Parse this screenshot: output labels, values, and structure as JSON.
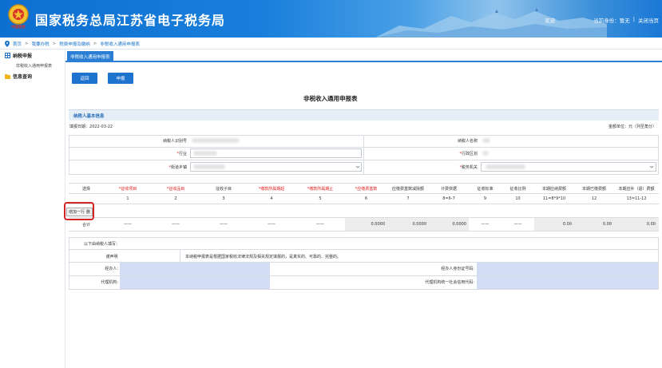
{
  "header": {
    "title": "国家税务总局江苏省电子税务局",
    "emblem_text": "中国税务",
    "links": [
      "欢迎",
      "当前身份：暂无",
      "|",
      "关闭当页"
    ]
  },
  "breadcrumb": [
    "首页",
    "我要办税",
    "税费申报及缴纳",
    "非税收入通用申报表"
  ],
  "sidebar": {
    "groups": [
      {
        "label": "纳税申报",
        "items": [
          "非税收入通用申报表"
        ]
      },
      {
        "label": "信息查询",
        "items": []
      }
    ]
  },
  "tab": {
    "label": "非税收入通用申报表"
  },
  "buttons": {
    "back": "返回",
    "declare": "申报"
  },
  "form_title": "非税收入通用申报表",
  "section": {
    "basic_info": "纳税人基本信息"
  },
  "meta": {
    "fill_date_label": "填报日期：",
    "fill_date": "2022-03-22",
    "unit": "金额单位：元（列至角分）"
  },
  "fields": {
    "taxpayer_id": "纳税人识别号",
    "taxpayer_name": "纳税人名称",
    "industry": "行业",
    "admin_region": "行政区划",
    "street": "街道乡镇",
    "tax_office": "税务机关"
  },
  "table": {
    "headers": [
      "选择",
      "征收项目",
      "征收品目",
      "征收子目",
      "缴款所属期起",
      "缴款所属期止",
      "应缴费基数",
      "应缴费基数减除额",
      "计费依据",
      "征收标准",
      "征收比例",
      "本期应纳费额",
      "本期已缴费额",
      "本期应补（退）费额"
    ],
    "required": [
      false,
      true,
      true,
      false,
      true,
      true,
      true,
      false,
      false,
      false,
      false,
      false,
      false,
      false
    ],
    "numbers": [
      "",
      "1",
      "2",
      "3",
      "4",
      "5",
      "6",
      "7",
      "8=6-7",
      "9",
      "10",
      "11=8*9*10",
      "12",
      "13=11-12"
    ],
    "add_row_label": "增加一行",
    "delete_label": "删",
    "total_label": "合计",
    "dash": "——",
    "totals": {
      "base": "0.0000",
      "deduct": "0.0000",
      "calc": "0.0000",
      "due": "0.00",
      "paid": "0.00",
      "refund": "0.00"
    }
  },
  "declaration": {
    "title": "以下由纳税人填写：",
    "statement_label": "谨声明",
    "statement": "本纳税申报表是根据国家税收法律法规及相关规定填报的，是真实的、可靠的、完整的。",
    "handler": "经办人:",
    "handler_id": "经办人身份证号码:",
    "agency": "代理机构:",
    "agency_code": "代理机构统一社会信用代码:"
  }
}
